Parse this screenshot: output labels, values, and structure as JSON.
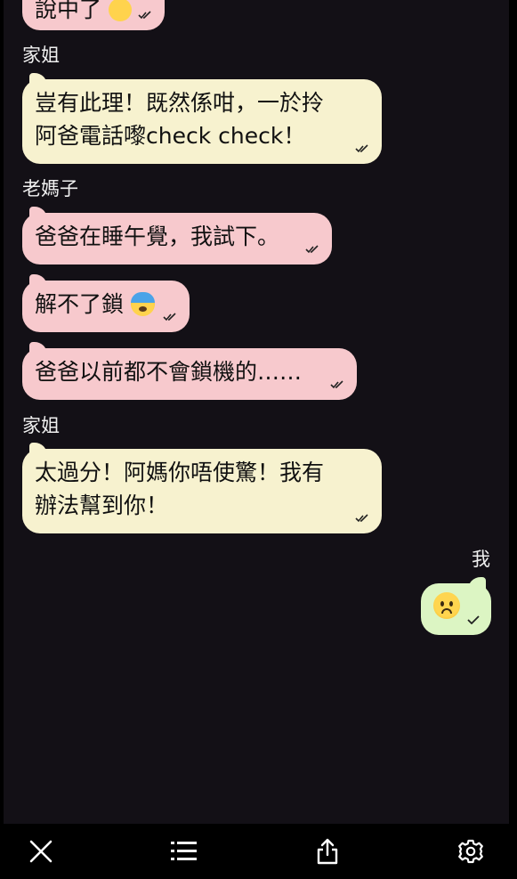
{
  "messages": [
    {
      "text": "說中了",
      "emoji": "loudly-crying-face-emoji",
      "color": "#f7c9cd"
    },
    {
      "sender": "家姐"
    },
    {
      "line1": "豈有此理！既然係咁，一於拎",
      "line2": "阿爸電話嚟check check！",
      "color": "#f7f2cf"
    },
    {
      "sender": "老媽子"
    },
    {
      "text": "爸爸在睡午覺，我試下。",
      "color": "#f7c9cd"
    },
    {
      "text": "解不了鎖",
      "emoji": "anxious-face-with-sweat-emoji"
    },
    {
      "text": "爸爸以前都不會鎖機的……"
    },
    {
      "sender": "家姐"
    },
    {
      "line1": "太過分！阿媽你唔使驚！我有",
      "line2": "辦法幫到你！"
    },
    {
      "sender": "我"
    },
    {
      "emoji": "frowning-face-emoji",
      "color": "#dcf5c3"
    }
  ],
  "toolbar": {
    "icons": [
      "close-icon",
      "list-icon",
      "share-icon",
      "gear-icon"
    ]
  }
}
